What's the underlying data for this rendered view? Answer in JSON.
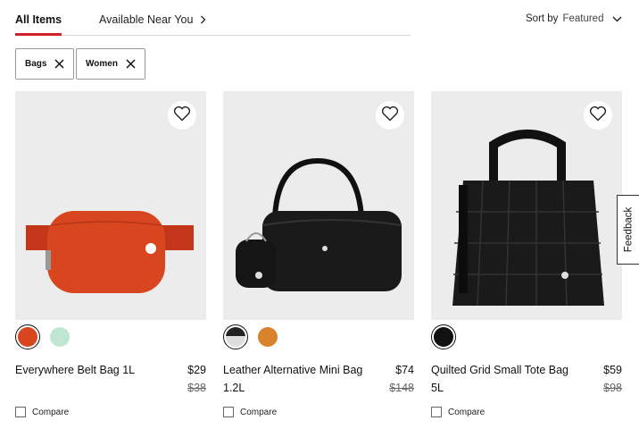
{
  "tabs": {
    "all_items": "All Items",
    "available_near_you": "Available Near You"
  },
  "sort": {
    "label": "Sort by",
    "value": "Featured"
  },
  "filters": [
    {
      "label": "Bags"
    },
    {
      "label": "Women"
    }
  ],
  "products": [
    {
      "name": "Everywhere Belt Bag 1L",
      "price": "$29",
      "original_price": "$38",
      "swatches": [
        "#d8461f",
        "#bfe6d0"
      ],
      "selected_swatch": 0,
      "compare_label": "Compare"
    },
    {
      "name": "Leather Alternative Mini Bag 1.2L",
      "price": "$74",
      "original_price": "$148",
      "swatches": [
        "split-black-white",
        "#d9822b"
      ],
      "selected_swatch": 0,
      "compare_label": "Compare"
    },
    {
      "name": "Quilted Grid Small Tote Bag 5L",
      "price": "$59",
      "original_price": "$98",
      "swatches": [
        "#111111"
      ],
      "selected_swatch": 0,
      "compare_label": "Compare"
    }
  ],
  "feedback": "Feedback",
  "colors": {
    "accent": "#d31f28"
  }
}
